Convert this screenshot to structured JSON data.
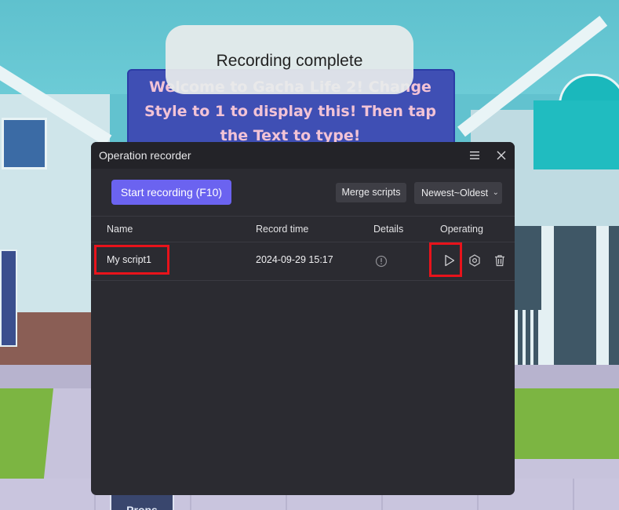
{
  "background": {
    "welcome_text": "Welcome to Gacha Life 2! Change Style to 1 to display this! Then tap the Text to type!",
    "props_label": "Props"
  },
  "toast": {
    "text": "Recording complete"
  },
  "panel": {
    "title": "Operation recorder",
    "menu_icon": "hamburger-menu-icon",
    "close_icon": "close-icon",
    "start_button": "Start recording  (F10)",
    "merge_button": "Merge scripts",
    "sort": {
      "selected": "Newest~Oldest"
    },
    "columns": [
      "Name",
      "Record time",
      "Details",
      "Operating"
    ],
    "rows": [
      {
        "name": "My script1",
        "record_time": "2024-09-29 15:17",
        "details_icon": "info-icon",
        "actions": [
          "play-icon",
          "settings-icon",
          "trash-icon"
        ]
      }
    ]
  },
  "colors": {
    "accent": "#6b63f0",
    "panel_bg": "#2b2b31",
    "highlight": "#e8131b"
  }
}
